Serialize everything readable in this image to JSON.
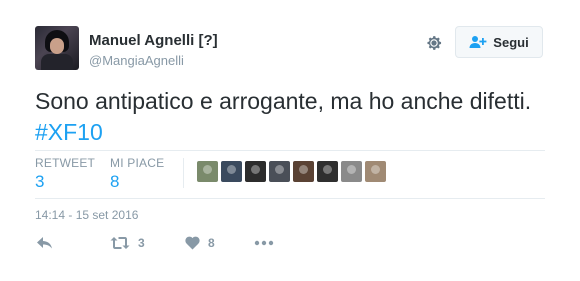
{
  "author": {
    "display_name": "Manuel Agnelli [?]",
    "handle": "@MangiaAgnelli"
  },
  "follow_button": {
    "label": "Segui"
  },
  "tweet": {
    "text": "Sono antipatico e arrogante, ma ho anche difetti.",
    "hashtag": "#XF10"
  },
  "stats": {
    "retweets": {
      "label": "RETWEET",
      "value": "3"
    },
    "likes": {
      "label": "MI PIACE",
      "value": "8"
    }
  },
  "likers": [
    {
      "icon": "avatar-1",
      "color": "#7a8a6b"
    },
    {
      "icon": "avatar-2",
      "color": "#3a4a5e"
    },
    {
      "icon": "avatar-3",
      "color": "#2c2c2c"
    },
    {
      "icon": "avatar-4",
      "color": "#4a4f58"
    },
    {
      "icon": "avatar-5",
      "color": "#5a4234"
    },
    {
      "icon": "avatar-6",
      "color": "#2f2f2f"
    },
    {
      "icon": "avatar-7",
      "color": "#8a8a8a"
    },
    {
      "icon": "avatar-8",
      "color": "#a08a74"
    }
  ],
  "timestamp": "14:14 - 15 set 2016",
  "actions": {
    "reply": {
      "icon": "reply-icon"
    },
    "retweet": {
      "icon": "retweet-icon",
      "count": "3"
    },
    "like": {
      "icon": "heart-icon",
      "count": "8"
    },
    "more": {
      "icon": "more-icon"
    }
  },
  "colors": {
    "accent": "#1da1f2",
    "muted": "#8899a6",
    "text": "#292f33"
  }
}
